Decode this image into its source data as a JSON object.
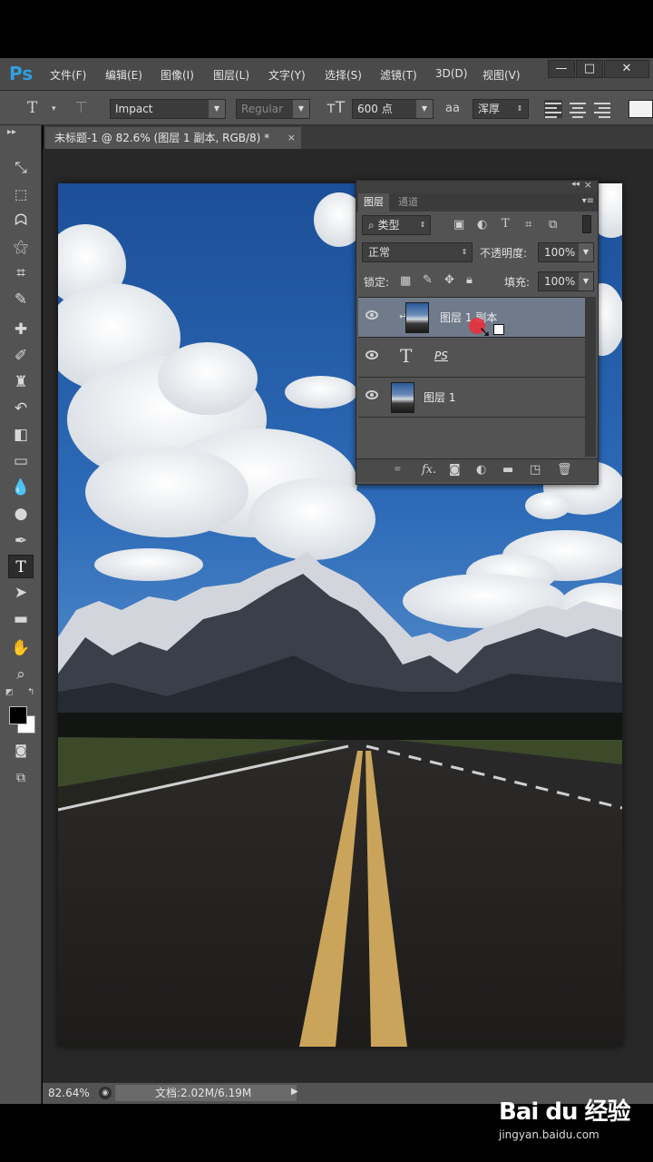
{
  "app": {
    "logo": "Ps"
  },
  "menu": [
    "文件(F)",
    "编辑(E)",
    "图像(I)",
    "图层(L)",
    "文字(Y)",
    "选择(S)",
    "滤镜(T)",
    "3D(D)",
    "视图(V)"
  ],
  "window_controls": {
    "minimize": "—",
    "restore": "□",
    "close": "✕"
  },
  "options": {
    "tool_glyph": "T",
    "font_family": "Impact",
    "font_style": "Regular",
    "font_size": "600 点",
    "aa_label": "aa",
    "antialias": "浑厚"
  },
  "document_tab": {
    "title": "未标题-1 @ 82.6% (图层 1 副本, RGB/8) *",
    "close": "×"
  },
  "tools": [
    "move-tool",
    "marquee-tool",
    "lasso-tool",
    "magic-wand-tool",
    "crop-tool",
    "eyedropper-tool",
    "healing-tool",
    "brush-tool",
    "stamp-tool",
    "history-brush-tool",
    "eraser-tool",
    "gradient-tool",
    "blur-tool",
    "dodge-tool",
    "pen-tool",
    "type-tool",
    "path-select-tool",
    "shape-tool",
    "hand-tool",
    "zoom-tool"
  ],
  "status": {
    "zoom": "82.64%",
    "doc_size": "文档:2.02M/6.19M"
  },
  "layers_panel": {
    "tab_layers": "图层",
    "tab_channels": "通道",
    "filter_kind": "类型",
    "blend_mode": "正常",
    "opacity_label": "不透明度:",
    "opacity_value": "100%",
    "lock_label": "锁定:",
    "fill_label": "填充:",
    "fill_value": "100%",
    "type_glyph": "T",
    "layers": [
      {
        "name": "图层 1 副本",
        "kind": "image",
        "selected": true
      },
      {
        "name": "PS",
        "kind": "text",
        "selected": false
      },
      {
        "name": "图层 1",
        "kind": "image",
        "selected": false
      }
    ]
  },
  "watermark": {
    "logo": "Bai du 经验",
    "url": "jingyan.baidu.com"
  },
  "colors": {
    "accent": "#2fa0e0",
    "selection": "#6f7a8a",
    "panel": "#535353"
  }
}
